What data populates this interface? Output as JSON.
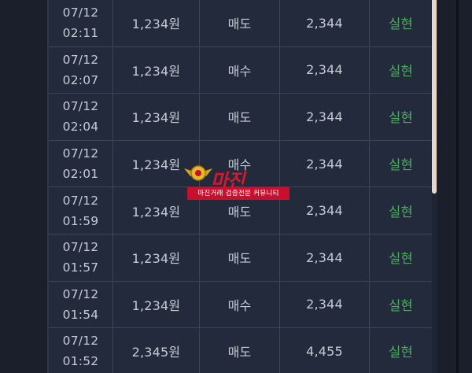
{
  "trades": [
    {
      "date": "07/12",
      "time": "02:11",
      "price": "1,234원",
      "type": "매도",
      "qty": "2,344",
      "status": "실현"
    },
    {
      "date": "07/12",
      "time": "02:07",
      "price": "1,234원",
      "type": "매수",
      "qty": "2,344",
      "status": "실현"
    },
    {
      "date": "07/12",
      "time": "02:04",
      "price": "1,234원",
      "type": "매도",
      "qty": "2,344",
      "status": "실현"
    },
    {
      "date": "07/12",
      "time": "02:01",
      "price": "1,234원",
      "type": "매수",
      "qty": "2,344",
      "status": "실현"
    },
    {
      "date": "07/12",
      "time": "01:59",
      "price": "1,234원",
      "type": "매도",
      "qty": "2,344",
      "status": "실현"
    },
    {
      "date": "07/12",
      "time": "01:57",
      "price": "1,234원",
      "type": "매도",
      "qty": "2,344",
      "status": "실현"
    },
    {
      "date": "07/12",
      "time": "01:54",
      "price": "1,234원",
      "type": "매수",
      "qty": "2,344",
      "status": "실현"
    },
    {
      "date": "07/12",
      "time": "01:52",
      "price": "2,345원",
      "type": "매도",
      "qty": "4,455",
      "status": "실현"
    }
  ],
  "watermark": {
    "title": "마진",
    "subtitle": "마진거래 검증전문 커뮤니티"
  },
  "colors": {
    "background": "#1b1f2c",
    "panel": "#232a3b",
    "border": "#3c4458",
    "text": "#c6cbd6",
    "status": "#4cae60",
    "watermark_red": "#c8102e"
  }
}
